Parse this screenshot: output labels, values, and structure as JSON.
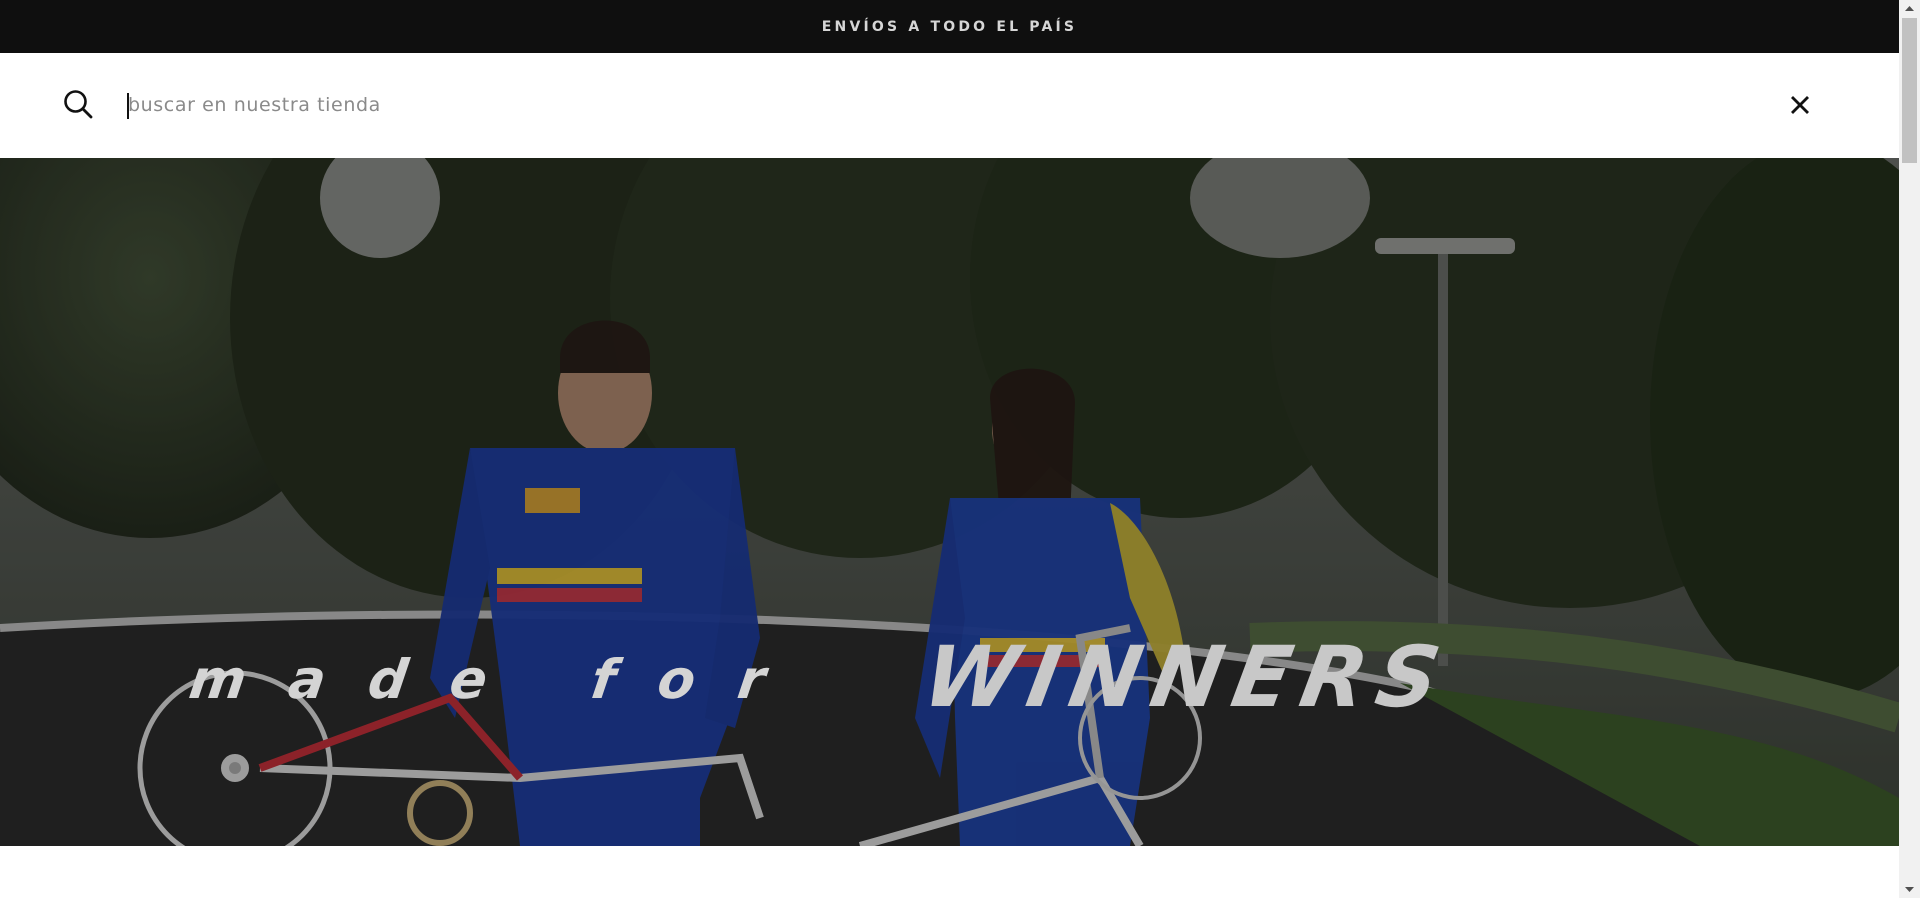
{
  "announcement": {
    "text": "ENVÍOS A TODO EL PAÍS"
  },
  "search": {
    "placeholder": "buscar en nuestra tienda",
    "value": ""
  },
  "hero": {
    "headline_light": "made for",
    "headline_bold": "WINNERS"
  },
  "colors": {
    "topbar": "#0f0f0f",
    "scrollbar_track": "#f1f1f1",
    "scrollbar_thumb": "#c1c1c1"
  },
  "icons": [
    "search-icon",
    "close-icon",
    "scroll-up-arrow",
    "scroll-down-arrow"
  ]
}
